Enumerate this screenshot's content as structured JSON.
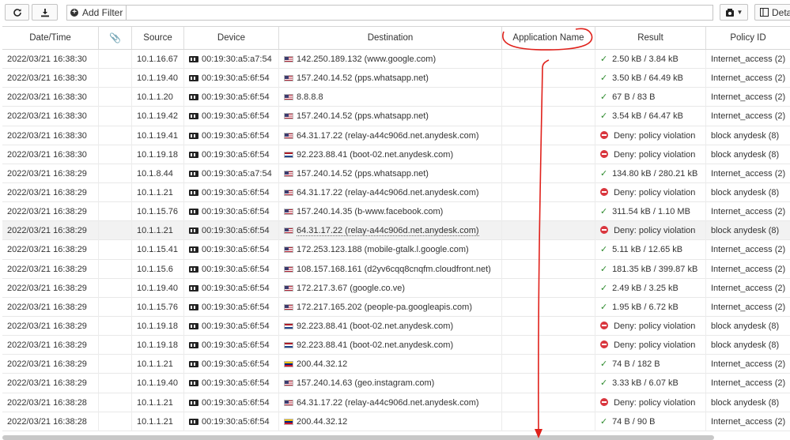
{
  "toolbar": {
    "refresh_icon": "refresh-icon",
    "download_icon": "download-icon",
    "add_filter_label": "Add Filter",
    "details_label": "Deta"
  },
  "columns": [
    "Date/Time",
    "",
    "Source",
    "Device",
    "Destination",
    "Application Name",
    "Result",
    "Policy ID"
  ],
  "rows": [
    {
      "date": "2022/03/21 16:38:30",
      "src": "10.1.16.67",
      "dev": "00:19:30:a5:a7:54",
      "flag": "us",
      "dst": "142.250.189.132 (www.google.com)",
      "ok": true,
      "res": "2.50 kB / 3.84 kB",
      "pol": "Internet_access (2)"
    },
    {
      "date": "2022/03/21 16:38:30",
      "src": "10.1.19.40",
      "dev": "00:19:30:a5:6f:54",
      "flag": "us",
      "dst": "157.240.14.52 (pps.whatsapp.net)",
      "ok": true,
      "res": "3.50 kB / 64.49 kB",
      "pol": "Internet_access (2)"
    },
    {
      "date": "2022/03/21 16:38:30",
      "src": "10.1.1.20",
      "dev": "00:19:30:a5:6f:54",
      "flag": "us",
      "dst": "8.8.8.8",
      "ok": true,
      "res": "67 B / 83 B",
      "pol": "Internet_access (2)"
    },
    {
      "date": "2022/03/21 16:38:30",
      "src": "10.1.19.42",
      "dev": "00:19:30:a5:6f:54",
      "flag": "us",
      "dst": "157.240.14.52 (pps.whatsapp.net)",
      "ok": true,
      "res": "3.54 kB / 64.47 kB",
      "pol": "Internet_access (2)"
    },
    {
      "date": "2022/03/21 16:38:30",
      "src": "10.1.19.41",
      "dev": "00:19:30:a5:6f:54",
      "flag": "us",
      "dst": "64.31.17.22 (relay-a44c906d.net.anydesk.com)",
      "ok": false,
      "res": "Deny: policy violation",
      "pol": "block anydesk (8)"
    },
    {
      "date": "2022/03/21 16:38:30",
      "src": "10.1.19.18",
      "dev": "00:19:30:a5:6f:54",
      "flag": "nl",
      "dst": "92.223.88.41 (boot-02.net.anydesk.com)",
      "ok": false,
      "res": "Deny: policy violation",
      "pol": "block anydesk (8)"
    },
    {
      "date": "2022/03/21 16:38:29",
      "src": "10.1.8.44",
      "dev": "00:19:30:a5:a7:54",
      "flag": "us",
      "dst": "157.240.14.52 (pps.whatsapp.net)",
      "ok": true,
      "res": "134.80 kB / 280.21 kB",
      "pol": "Internet_access (2)"
    },
    {
      "date": "2022/03/21 16:38:29",
      "src": "10.1.1.21",
      "dev": "00:19:30:a5:6f:54",
      "flag": "us",
      "dst": "64.31.17.22 (relay-a44c906d.net.anydesk.com)",
      "ok": false,
      "res": "Deny: policy violation",
      "pol": "block anydesk (8)"
    },
    {
      "date": "2022/03/21 16:38:29",
      "src": "10.1.15.76",
      "dev": "00:19:30:a5:6f:54",
      "flag": "us",
      "dst": "157.240.14.35 (b-www.facebook.com)",
      "ok": true,
      "res": "311.54 kB / 1.10 MB",
      "pol": "Internet_access (2)"
    },
    {
      "date": "2022/03/21 16:38:29",
      "src": "10.1.1.21",
      "dev": "00:19:30:a5:6f:54",
      "flag": "us",
      "dst": "64.31.17.22 (relay-a44c906d.net.anydesk.com)",
      "ok": false,
      "res": "Deny: policy violation",
      "pol": "block anydesk (8)",
      "highlight": true
    },
    {
      "date": "2022/03/21 16:38:29",
      "src": "10.1.15.41",
      "dev": "00:19:30:a5:6f:54",
      "flag": "us",
      "dst": "172.253.123.188 (mobile-gtalk.l.google.com)",
      "ok": true,
      "res": "5.11 kB / 12.65 kB",
      "pol": "Internet_access (2)"
    },
    {
      "date": "2022/03/21 16:38:29",
      "src": "10.1.15.6",
      "dev": "00:19:30:a5:6f:54",
      "flag": "us",
      "dst": "108.157.168.161 (d2yv6cqq8cnqfm.cloudfront.net)",
      "ok": true,
      "res": "181.35 kB / 399.87 kB",
      "pol": "Internet_access (2)"
    },
    {
      "date": "2022/03/21 16:38:29",
      "src": "10.1.19.40",
      "dev": "00:19:30:a5:6f:54",
      "flag": "us",
      "dst": "172.217.3.67 (google.co.ve)",
      "ok": true,
      "res": "2.49 kB / 3.25 kB",
      "pol": "Internet_access (2)"
    },
    {
      "date": "2022/03/21 16:38:29",
      "src": "10.1.15.76",
      "dev": "00:19:30:a5:6f:54",
      "flag": "us",
      "dst": "172.217.165.202 (people-pa.googleapis.com)",
      "ok": true,
      "res": "1.95 kB / 6.72 kB",
      "pol": "Internet_access (2)"
    },
    {
      "date": "2022/03/21 16:38:29",
      "src": "10.1.19.18",
      "dev": "00:19:30:a5:6f:54",
      "flag": "nl",
      "dst": "92.223.88.41 (boot-02.net.anydesk.com)",
      "ok": false,
      "res": "Deny: policy violation",
      "pol": "block anydesk (8)"
    },
    {
      "date": "2022/03/21 16:38:29",
      "src": "10.1.19.18",
      "dev": "00:19:30:a5:6f:54",
      "flag": "nl",
      "dst": "92.223.88.41 (boot-02.net.anydesk.com)",
      "ok": false,
      "res": "Deny: policy violation",
      "pol": "block anydesk (8)"
    },
    {
      "date": "2022/03/21 16:38:29",
      "src": "10.1.1.21",
      "dev": "00:19:30:a5:6f:54",
      "flag": "ve",
      "dst": "200.44.32.12",
      "ok": true,
      "res": "74 B / 182 B",
      "pol": "Internet_access (2)"
    },
    {
      "date": "2022/03/21 16:38:29",
      "src": "10.1.19.40",
      "dev": "00:19:30:a5:6f:54",
      "flag": "us",
      "dst": "157.240.14.63 (geo.instagram.com)",
      "ok": true,
      "res": "3.33 kB / 6.07 kB",
      "pol": "Internet_access (2)"
    },
    {
      "date": "2022/03/21 16:38:28",
      "src": "10.1.1.21",
      "dev": "00:19:30:a5:6f:54",
      "flag": "us",
      "dst": "64.31.17.22 (relay-a44c906d.net.anydesk.com)",
      "ok": false,
      "res": "Deny: policy violation",
      "pol": "block anydesk (8)"
    },
    {
      "date": "2022/03/21 16:38:28",
      "src": "10.1.1.21",
      "dev": "00:19:30:a5:6f:54",
      "flag": "ve",
      "dst": "200.44.32.12",
      "ok": true,
      "res": "74 B / 90 B",
      "pol": "Internet_access (2)"
    }
  ],
  "colors": {
    "ok": "#2e8b2e",
    "deny": "#d9363e",
    "annotation": "#e0211b"
  }
}
